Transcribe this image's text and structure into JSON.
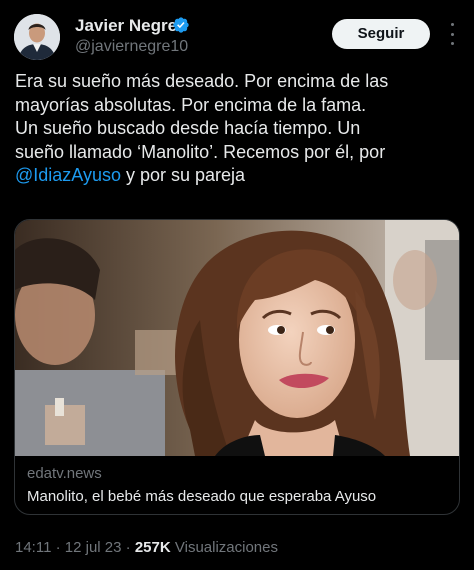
{
  "author": {
    "name": "Javier Negre",
    "handle": "@javiernegre10",
    "verified_icon": "verified-badge-icon",
    "verified_color": "#1d9bf0"
  },
  "actions": {
    "follow_label": "Seguir",
    "more_icon": "more-options-icon"
  },
  "tweet": {
    "lines": [
      "Era su sueño más deseado. Por encima de las",
      "mayorías absolutas. Por encima de la fama.",
      "Un sueño buscado desde hacía tiempo. Un",
      "sueño llamado ‘Manolito’. Recemos por él, por"
    ],
    "mention": "@IdiazAyuso",
    "after_mention": " y por su pareja",
    "link_color": "#1d9bf0"
  },
  "card": {
    "domain": "edatv.news",
    "title": "Manolito, el bebé más deseado que esperaba Ayuso"
  },
  "meta": {
    "time": "14:11",
    "separator": " · ",
    "date": "12 jul 23",
    "views_count": "257K",
    "views_label": "Visualizaciones"
  },
  "colors": {
    "background": "#000000",
    "text_primary": "#e7e9ea",
    "text_secondary": "#71767b",
    "border": "#2f3336",
    "button_bg": "#eff3f4"
  }
}
